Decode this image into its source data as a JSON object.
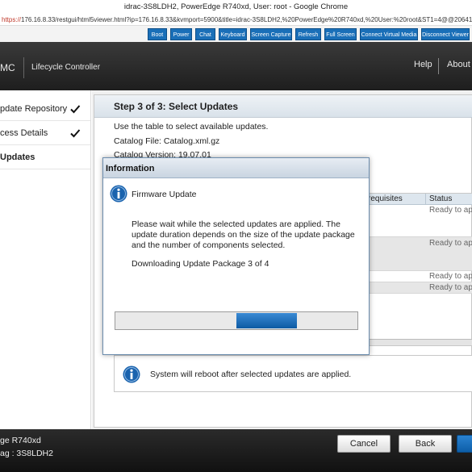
{
  "browser": {
    "window_title": "idrac-3S8LDH2, PowerEdge R740xd, User: root - Google Chrome",
    "url_scheme": "https://",
    "url_rest": "176.16.8.33/restgui/html5viewer.html?ip=176.16.8.33&kvmport=5900&title=idrac-3S8LDH2,%20PowerEdge%20R740xd,%20User:%20root&ST1=4@@20641172712"
  },
  "viewer_toolbar": {
    "buttons": [
      "Boot",
      "Power",
      "Chat",
      "Keyboard",
      "Screen Capture",
      "Refresh",
      "Full Screen",
      "Connect Virtual Media",
      "Disconnect Viewer"
    ]
  },
  "header": {
    "brand": "MC",
    "title": "Lifecycle Controller",
    "help": "Help",
    "about": "About"
  },
  "sidebar": {
    "items": [
      {
        "label": "pdate Repository",
        "done": true
      },
      {
        "label": "cess Details",
        "done": true
      },
      {
        "label": "Updates",
        "done": false
      }
    ]
  },
  "main": {
    "step_title": "Step 3 of 3: Select Updates",
    "instruction": "Use the table to select available updates.",
    "catalog_file": "Catalog File: Catalog.xml.gz",
    "catalog_version": "Catalog Version: 19.07.01",
    "table": {
      "col_prereq": "requisites",
      "col_status": "Status",
      "rows": [
        "Ready to appl",
        "Ready to appl",
        "Ready to appl",
        "Ready to appl"
      ]
    },
    "reboot_note": "System will reboot after selected updates are applied."
  },
  "dialog": {
    "title": "Information",
    "heading": "Firmware Update",
    "body": "Please wait while the selected updates are applied. The update duration depends on the size of the update package and the number of components selected.",
    "status": "Downloading Update Package 3 of 4",
    "progress_segment": {
      "start": 0.5,
      "end": 0.75
    }
  },
  "footer": {
    "model": "ge R740xd",
    "service_tag": "ag : 3S8LDH2",
    "cancel": "Cancel",
    "back": "Back",
    "finish": ""
  },
  "colors": {
    "accent": "#1a6fb8",
    "header_bg": "#2a2a2a",
    "progress": "#0c5aa3"
  }
}
